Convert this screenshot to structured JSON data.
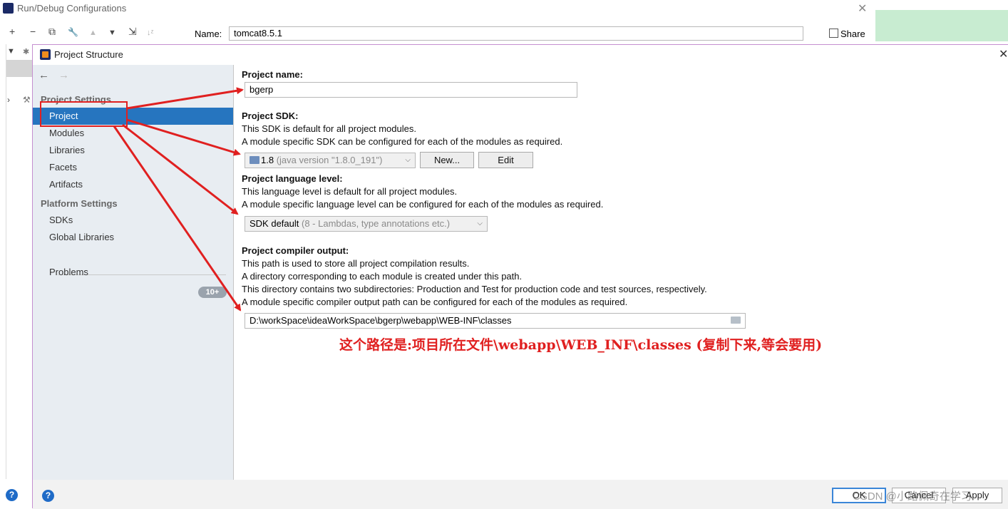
{
  "run_debug": {
    "title": "Run/Debug Configurations",
    "close_glyph": "✕",
    "toolbar_icons": [
      "+",
      "−",
      "⧉",
      "🔧",
      "▲",
      "▼",
      "⇲",
      "↓ᶻ"
    ],
    "name_label": "Name:",
    "name_value": "tomcat8.5.1",
    "share_label": "Share",
    "help_glyph": "?"
  },
  "project_structure": {
    "title": "Project Structure",
    "close_glyph": "✕",
    "nav": {
      "back": "←",
      "forward": "→"
    },
    "sidebar": {
      "project_settings_title": "Project Settings",
      "project_settings_items": [
        {
          "label": "Project",
          "selected": true
        },
        {
          "label": "Modules"
        },
        {
          "label": "Libraries"
        },
        {
          "label": "Facets"
        },
        {
          "label": "Artifacts"
        }
      ],
      "platform_settings_title": "Platform Settings",
      "platform_settings_items": [
        {
          "label": "SDKs"
        },
        {
          "label": "Global Libraries"
        }
      ],
      "problems_label": "Problems",
      "problems_badge": "10+"
    },
    "main": {
      "project_name_label": "Project name:",
      "project_name_value": "bgerp",
      "sdk_label": "Project SDK:",
      "sdk_desc_1": "This SDK is default for all project modules.",
      "sdk_desc_2": "A module specific SDK can be configured for each of the modules as required.",
      "sdk_value": "1.8",
      "sdk_value_detail": "(java version \"1.8.0_191\")",
      "sdk_new_button": "New...",
      "sdk_edit_button": "Edit",
      "lang_label": "Project language level:",
      "lang_desc_1": "This language level is default for all project modules.",
      "lang_desc_2": "A module specific language level can be configured for each of the modules as required.",
      "lang_value": "SDK default",
      "lang_value_detail": "(8 - Lambdas, type annotations etc.)",
      "output_label": "Project compiler output:",
      "output_desc_1": "This path is used to store all project compilation results.",
      "output_desc_2": "A directory corresponding to each module is created under this path.",
      "output_desc_3": "This directory contains two subdirectories: Production and Test for production code and test sources, respectively.",
      "output_desc_4": "A module specific compiler output path can be configured for each of the modules as required.",
      "output_value": "D:\\workSpace\\ideaWorkSpace\\bgerp\\webapp\\WEB-INF\\classes"
    },
    "footer": {
      "help_glyph": "?",
      "ok": "OK",
      "cancel": "Cancel",
      "apply": "Apply"
    }
  },
  "annotation_text": "这个路径是:项目所在文件\\webapp\\WEB_INF\\classes     (复制下来,等会要用)",
  "watermark": "CSDN @小路佩奇在学习",
  "colors": {
    "selection": "#2675bf",
    "annotation": "#e02020",
    "arrow": "#e02020",
    "sidebar_bg": "#e8edf2",
    "green_strip": "#c8ecd1"
  }
}
